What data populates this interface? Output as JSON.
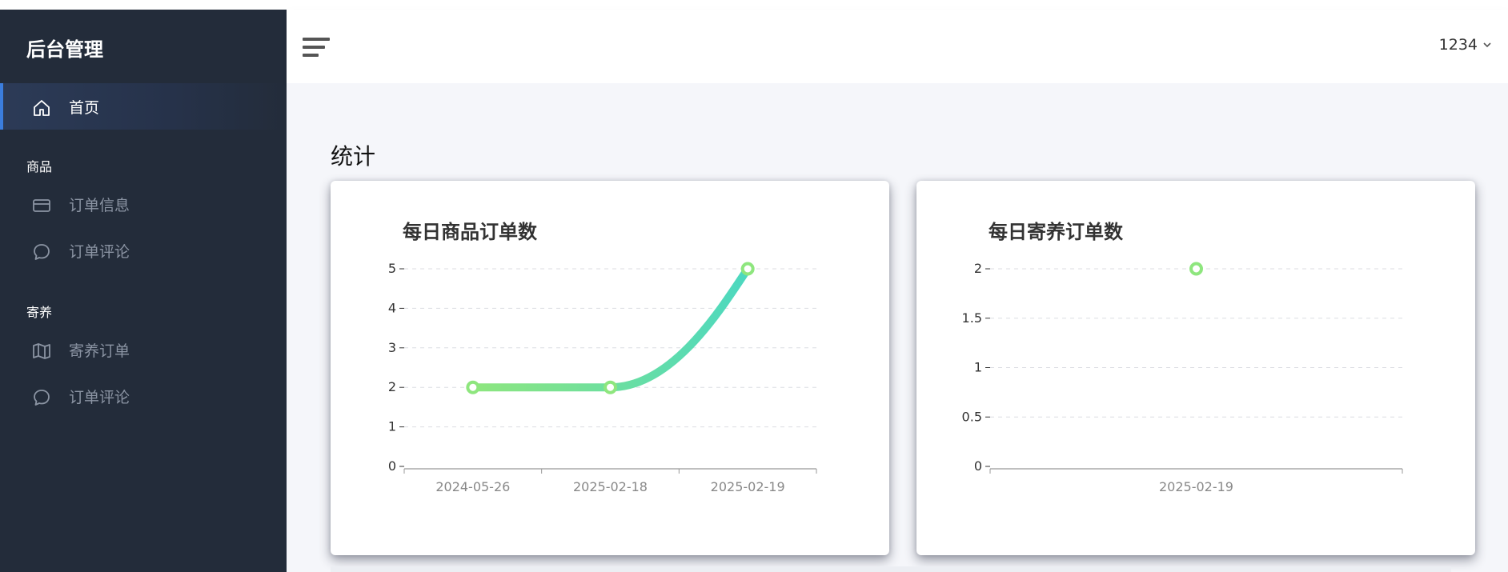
{
  "sidebar": {
    "brand": "后台管理",
    "home": {
      "label": "首页",
      "icon": "home-icon"
    },
    "groups": [
      {
        "title": "商品",
        "items": [
          {
            "label": "订单信息",
            "icon": "credit-card-icon"
          },
          {
            "label": "订单评论",
            "icon": "chat-bubble-icon"
          }
        ]
      },
      {
        "title": "寄养",
        "items": [
          {
            "label": "寄养订单",
            "icon": "map-icon"
          },
          {
            "label": "订单评论",
            "icon": "chat-bubble-icon"
          }
        ]
      }
    ]
  },
  "header": {
    "menu_icon": "hamburger-icon",
    "user_name": "1234",
    "user_icon": "chevron-down-icon"
  },
  "main": {
    "section_title": "统计"
  },
  "colors": {
    "sidebar_bg": "#232c3a",
    "accent": "#3b7ddd",
    "line_start": "#8ee67e",
    "line_end": "#4cd8c0"
  },
  "chart_data": [
    {
      "type": "line",
      "title": "每日商品订单数",
      "categories": [
        "2024-05-26",
        "2025-02-18",
        "2025-02-19"
      ],
      "values": [
        2,
        2,
        5
      ],
      "ylim": [
        0,
        5
      ],
      "yticks": [
        "0",
        "1",
        "2",
        "3",
        "4",
        "5"
      ],
      "grid": true,
      "smooth": true
    },
    {
      "type": "line",
      "title": "每日寄养订单数",
      "categories": [
        "2025-02-19"
      ],
      "values": [
        2
      ],
      "ylim": [
        0,
        2
      ],
      "yticks": [
        "0",
        "0.5",
        "1",
        "1.5",
        "2"
      ],
      "grid": true
    }
  ]
}
